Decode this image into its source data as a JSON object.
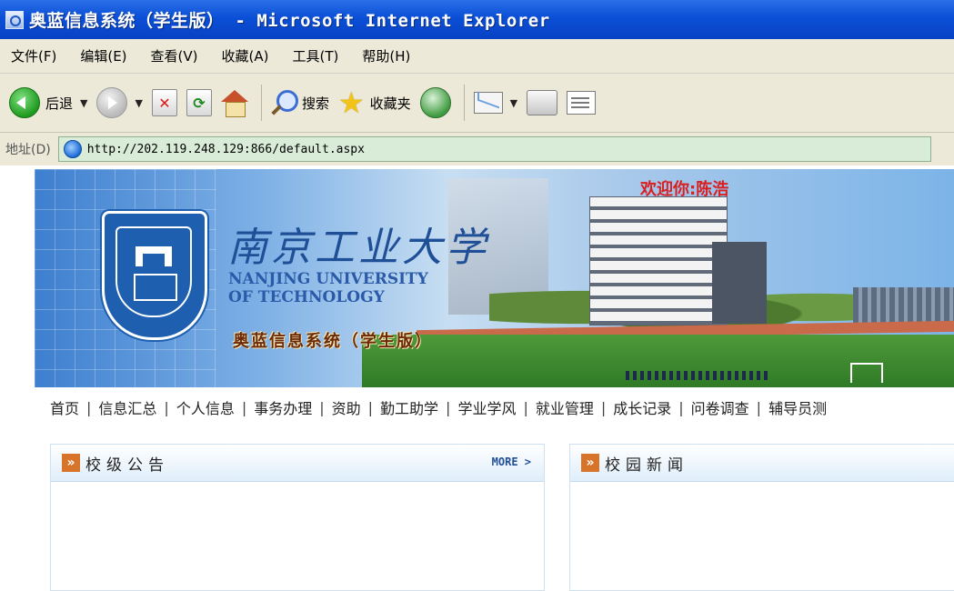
{
  "window": {
    "title": "奥蓝信息系统（学生版） - Microsoft Internet Explorer"
  },
  "menu": [
    "文件(F)",
    "编辑(E)",
    "查看(V)",
    "收藏(A)",
    "工具(T)",
    "帮助(H)"
  ],
  "toolbar": {
    "back_label": "后退",
    "search_label": "搜索",
    "favorites_label": "收藏夹"
  },
  "address": {
    "label": "地址(D)",
    "url": "http://202.119.248.129:866/default.aspx"
  },
  "banner": {
    "school_cn": "南京工业大学",
    "school_en_line1": "NANJING UNIVERSITY",
    "school_en_line2": "OF TECHNOLOGY",
    "system_name": "奥蓝信息系统（学生版）",
    "welcome": "欢迎你:陈浩"
  },
  "nav": [
    "首页",
    "信息汇总",
    "个人信息",
    "事务办理",
    "资助",
    "勤工助学",
    "学业学风",
    "就业管理",
    "成长记录",
    "问卷调查",
    "辅导员测"
  ],
  "panels": {
    "left": {
      "title": "校级公告",
      "more": "MORE >"
    },
    "right": {
      "title": "校园新闻"
    }
  },
  "colors": {
    "titlebar": "#0a4fd6",
    "chrome": "#ece9d8",
    "address_field": "#d8ecd8",
    "welcome_text": "#d91f1f",
    "panel_accent": "#d8742a"
  }
}
